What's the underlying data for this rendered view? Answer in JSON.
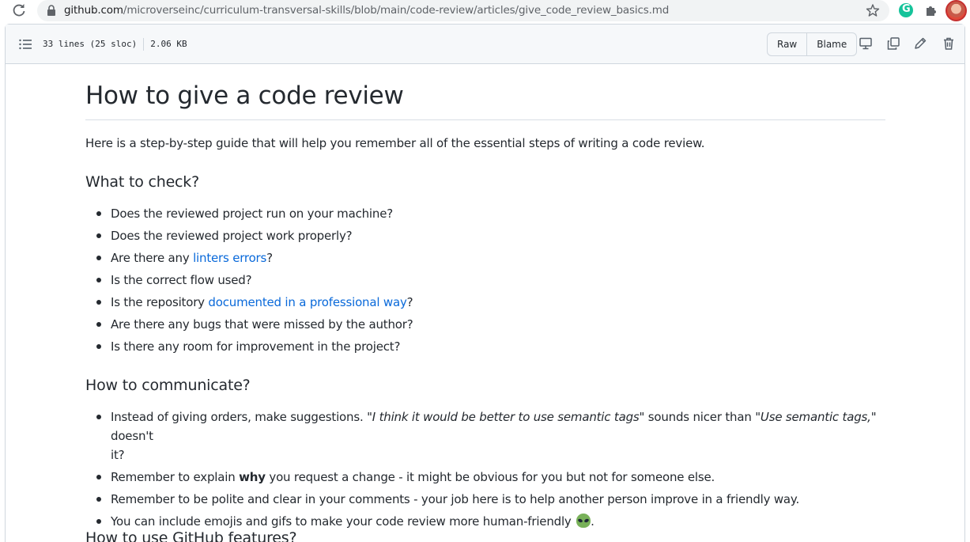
{
  "browser": {
    "url_host": "github.com",
    "url_path": "/microverseinc/curriculum-transversal-skills/blob/main/code-review/articles/give_code_review_basics.md",
    "extension_g_label": "G"
  },
  "file_header": {
    "lines": "33 lines (25 sloc)",
    "size": "2.06 KB",
    "raw_label": "Raw",
    "blame_label": "Blame"
  },
  "article": {
    "title": "How to give a code review",
    "intro": "Here is a step-by-step guide that will help you remember all of the essential steps of writing a code review.",
    "section1": {
      "heading": "What to check?",
      "items": {
        "i0": "Does the reviewed project run on your machine?",
        "i1": "Does the reviewed project work properly?",
        "i2_pre": "Are there any ",
        "i2_link": "linters errors",
        "i2_post": "?",
        "i3": "Is the correct flow used?",
        "i4_pre": "Is the repository ",
        "i4_link": "documented in a professional way",
        "i4_post": "?",
        "i5": "Are there any bugs that were missed by the author?",
        "i6": "Is there any room for improvement in the project?"
      }
    },
    "section2": {
      "heading": "How to communicate?",
      "items": {
        "i0_a": "Instead of giving orders, make suggestions. \"",
        "i0_em1": "I think it would be better to use semantic tags",
        "i0_b": "\" sounds nicer than \"",
        "i0_em2": "Use semantic tags,",
        "i0_c": "\" doesn't",
        "i0_d": "it?",
        "i1_a": "Remember to explain ",
        "i1_strong": "why",
        "i1_b": " you request a change - it might be obvious for you but not for someone else.",
        "i2": "Remember to be polite and clear in your comments - your job here is to help another person improve in a friendly way.",
        "i3_a": "You can include emojis and gifs to make your code review more human-friendly ",
        "i3_b": "."
      }
    },
    "section3": {
      "heading": "How to use GitHub features?"
    }
  }
}
